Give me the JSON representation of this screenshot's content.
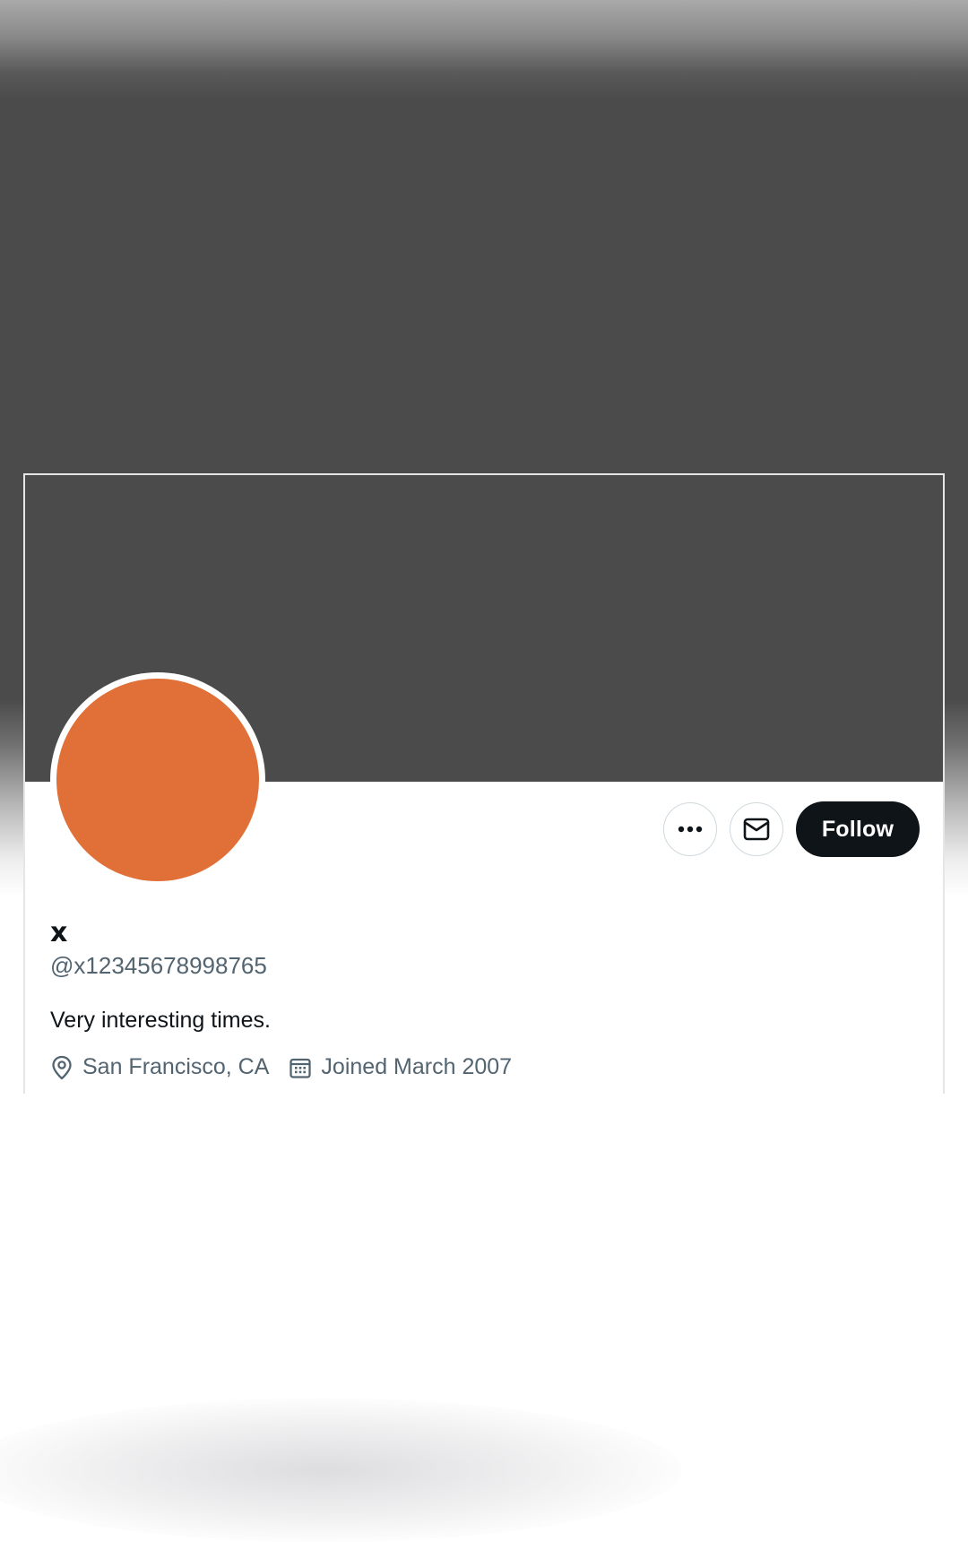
{
  "profile": {
    "name": "x",
    "handle": "@x12345678998765",
    "bio": "Very interesting times.",
    "location": "San Francisco, CA",
    "joined": "Joined March 2007"
  },
  "actions": {
    "more_icon": "more-horizontal-icon",
    "message_icon": "envelope-icon",
    "follow_label": "Follow"
  },
  "colors": {
    "banner": "#4b4b4b",
    "avatar": "#e07037",
    "follow_button": "#0f1419",
    "secondary_text": "#536471"
  }
}
